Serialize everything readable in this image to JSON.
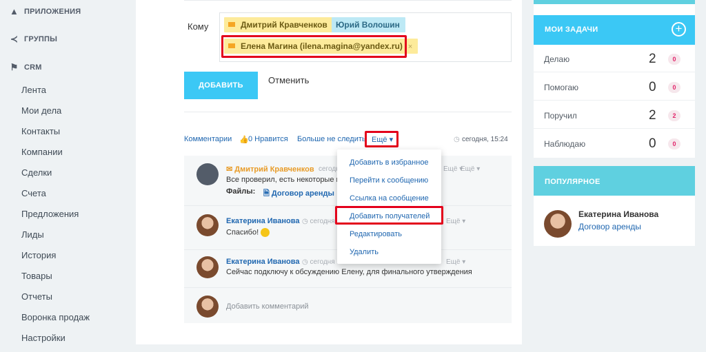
{
  "sidebar": {
    "sections": [
      {
        "label": "ПРИЛОЖЕНИЯ",
        "icon": "apps-icon"
      },
      {
        "label": "ГРУППЫ",
        "icon": "share-icon"
      },
      {
        "label": "CRM",
        "icon": "flag-icon"
      }
    ],
    "items": [
      "Лента",
      "Мои дела",
      "Контакты",
      "Компании",
      "Сделки",
      "Счета",
      "Предложения",
      "Лиды",
      "История",
      "Товары",
      "Отчеты",
      "Воронка продаж",
      "Настройки"
    ]
  },
  "recipients": {
    "label": "Кому",
    "tags": [
      {
        "name": "Дмитрий Кравченков"
      },
      {
        "name": "Юрий Волошин"
      },
      {
        "name": "Елена Магина (ilena.magina@yandex.ru)",
        "remove": "×"
      }
    ]
  },
  "form": {
    "add_button": "ДОБАВИТЬ",
    "cancel": "Отменить"
  },
  "actions": {
    "comments": "Комментарии",
    "likes": "0 Нравится",
    "unfollow": "Больше не следить",
    "more": "Ещё",
    "timestamp": "сегодня, 15:24"
  },
  "comments": [
    {
      "author": "Дмитрий Кравченков",
      "time": "сегодня",
      "more": "Ещё",
      "text": "Все проверил, есть некоторые м",
      "files_label": "Файлы:",
      "file": "Договор аренды"
    },
    {
      "author": "Екатерина Иванова",
      "time": "сегодня",
      "more": "Ещё",
      "text": "Спасибо!"
    },
    {
      "author": "Екатерина Иванова",
      "time": "сегодня",
      "more": "Ещё",
      "text": "Сейчас подключу к обсуждению Елену, для финального утверждения"
    }
  ],
  "add_comment_placeholder": "Добавить комментарий",
  "menu": [
    "Добавить в избранное",
    "Перейти к сообщению",
    "Ссылка на сообщение",
    "Добавить получателей",
    "Редактировать",
    "Удалить"
  ],
  "tasks": {
    "title": "МОИ ЗАДАЧИ",
    "rows": [
      {
        "label": "Делаю",
        "count": "2",
        "badge": "0"
      },
      {
        "label": "Помогаю",
        "count": "0",
        "badge": "0"
      },
      {
        "label": "Поручил",
        "count": "2",
        "badge": "2"
      },
      {
        "label": "Наблюдаю",
        "count": "0",
        "badge": "0"
      }
    ]
  },
  "popular": {
    "title": "ПОПУЛЯРНОЕ",
    "name": "Екатерина Иванова",
    "link": "Договор аренды"
  },
  "colors": {
    "accent": "#3bc8f5",
    "link": "#2067b0",
    "highlight": "#e3001b",
    "tag_yellow": "#fdeb9b",
    "tag_blue": "#bde9f5"
  }
}
